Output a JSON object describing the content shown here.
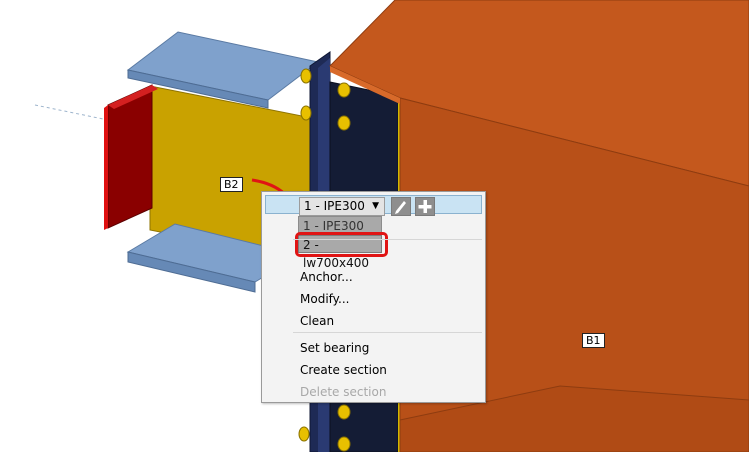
{
  "scene": {
    "members": [
      {
        "id": "B1",
        "color": "#c4581d"
      },
      {
        "id": "B2",
        "color": "#c9a200"
      }
    ],
    "colors": {
      "flange": "#7fa1cc",
      "end_plate": "#cc0000",
      "column": "#1e2a55",
      "bolt": "#e8c000"
    }
  },
  "context_menu": {
    "section_select": {
      "value": "1 - IPE300",
      "options": [
        "1 - IPE300",
        "2 - lw700x400"
      ],
      "highlighted_option": "2 - lw700x400"
    },
    "header_icons": [
      "pencil-icon",
      "plus-icon"
    ],
    "items": {
      "anchor": "Anchor...",
      "modify": "Modify...",
      "clean": "Clean",
      "set_bearing": "Set bearing",
      "create_section": "Create section",
      "delete_section": "Delete section"
    },
    "disabled_items": [
      "Delete section"
    ]
  },
  "annotation": {
    "arrow_color": "#e01414"
  }
}
